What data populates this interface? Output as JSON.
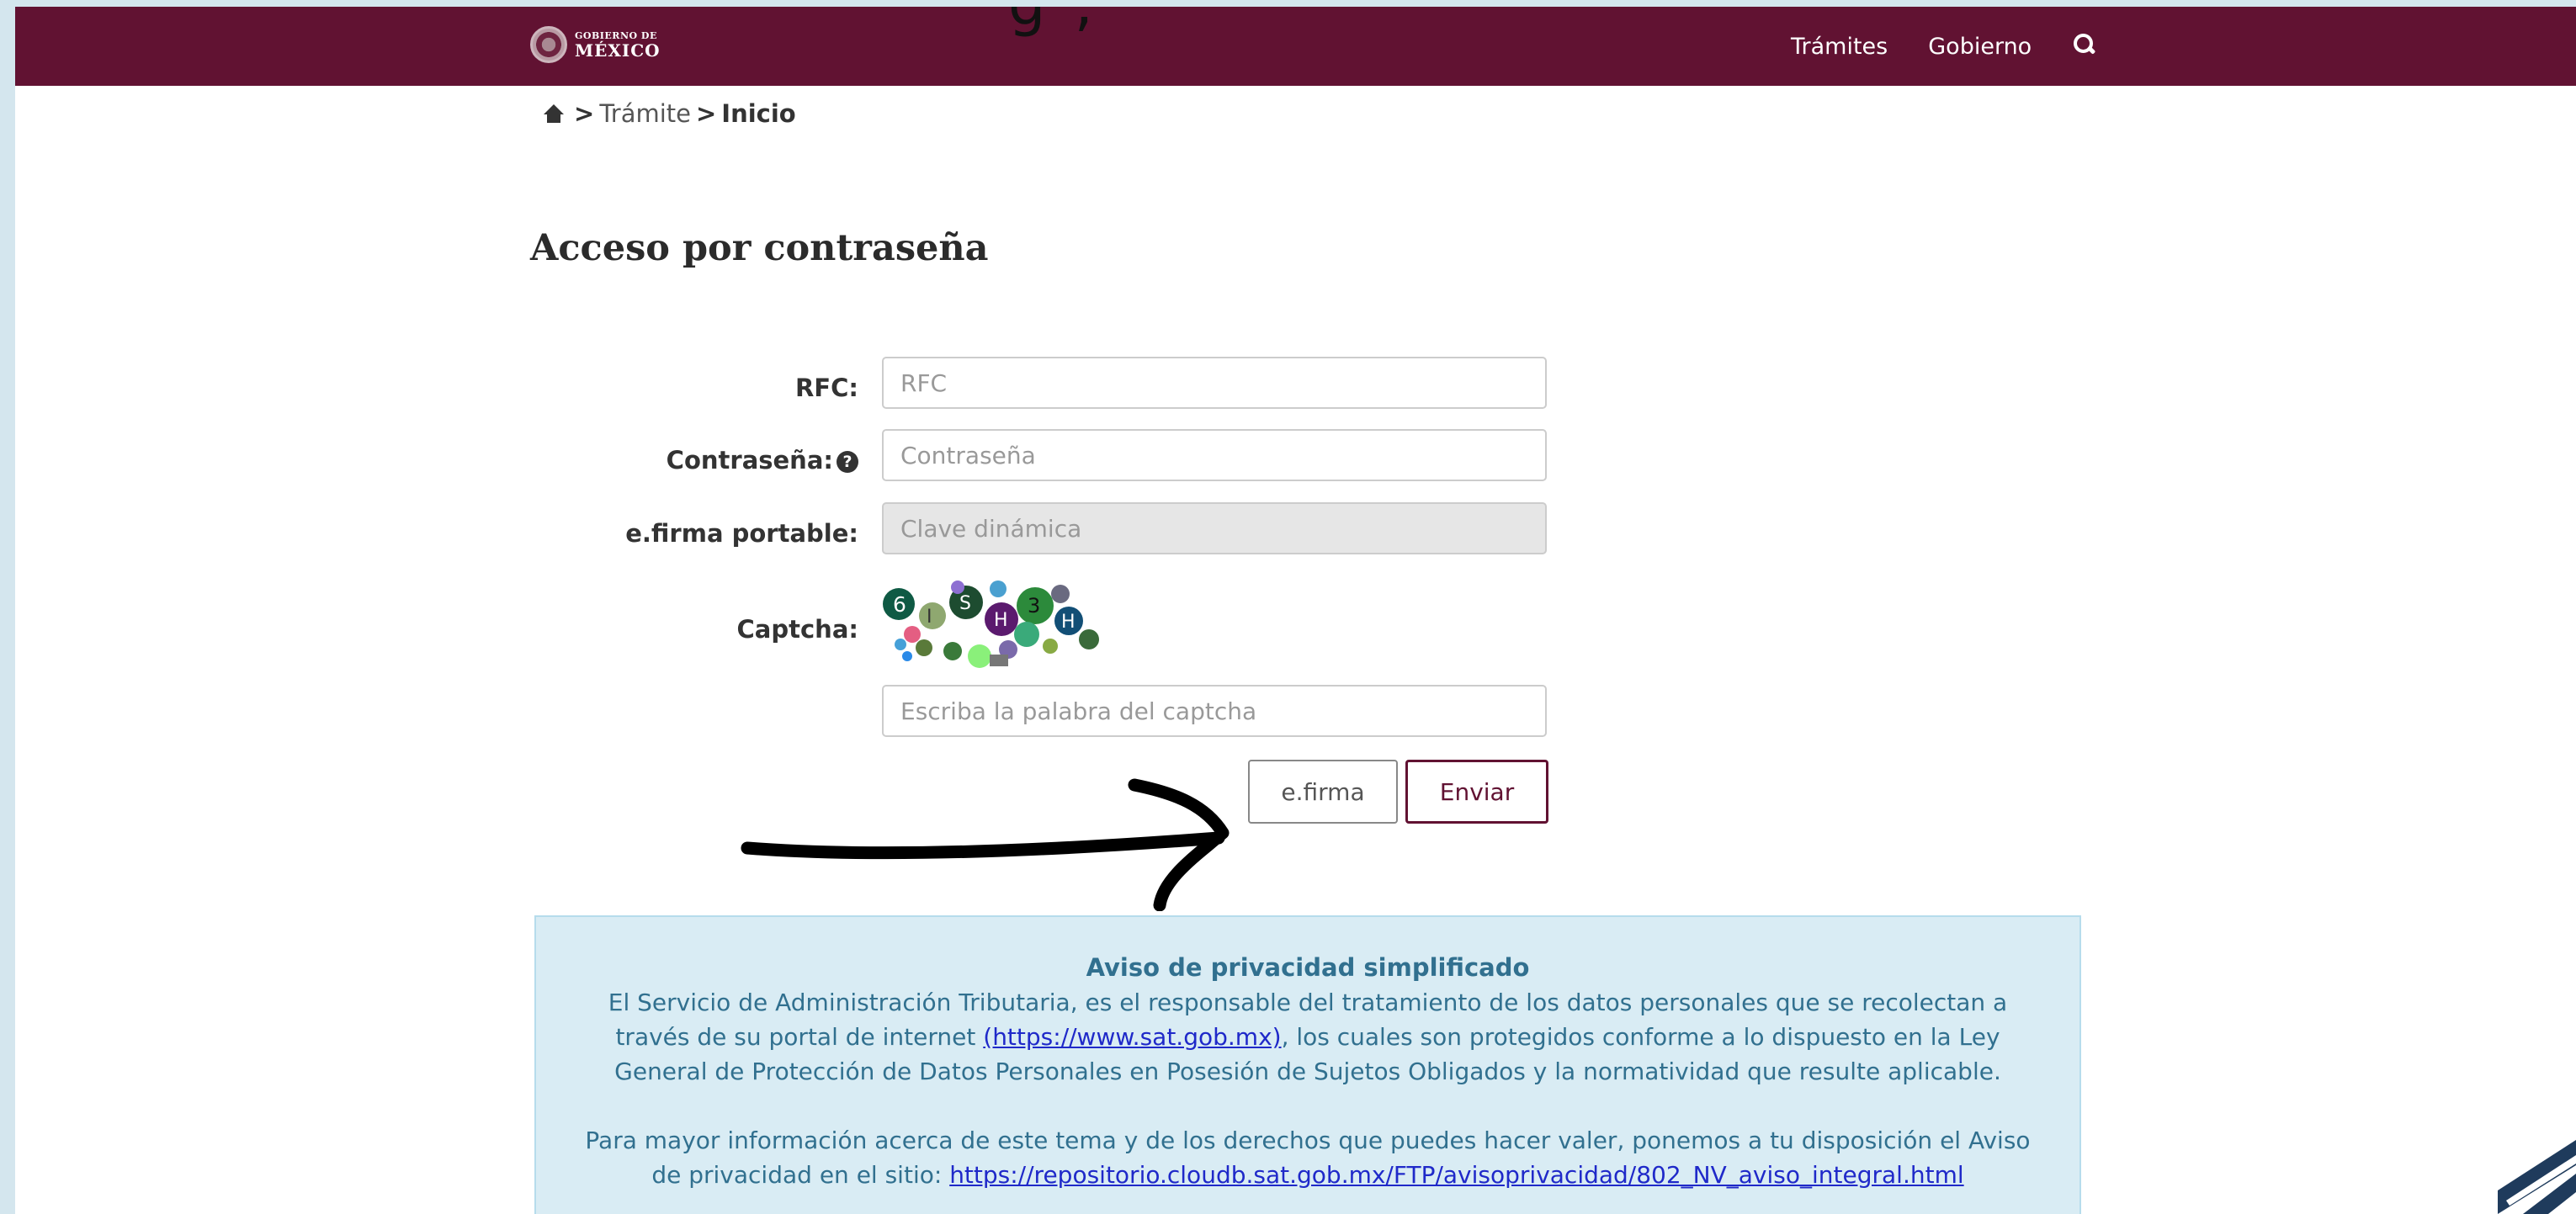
{
  "navbar": {
    "logo_small": "GOBIERNO DE",
    "logo_big": "MÉXICO",
    "links": [
      "Trámites",
      "Gobierno"
    ],
    "search_icon": "search-icon",
    "bg_color": "#611232"
  },
  "breadcrumb": {
    "home_icon": "home-icon",
    "separator": ">",
    "items": [
      "Trámite",
      "Inicio"
    ]
  },
  "page": {
    "title": "Acceso por contraseña"
  },
  "form": {
    "rfc_label": "RFC:",
    "rfc_placeholder": "RFC",
    "password_label": "Contraseña:",
    "password_placeholder": "Contraseña",
    "help_icon": "question-circle-icon",
    "efirma_label": "e.firma portable:",
    "efirma_placeholder": "Clave dinámica",
    "captcha_label": "Captcha:",
    "captcha_placeholder": "Escriba la palabra del captcha",
    "btn_efirma": "e.firma",
    "btn_enviar": "Enviar"
  },
  "privacy": {
    "title": "Aviso de privacidad simplificado",
    "p1_a": "El Servicio de Administración Tributaria, es el responsable del tratamiento de los datos personales que se recolectan a través de su portal de internet ",
    "p1_link": "(https://www.sat.gob.mx)",
    "p1_b": ", los cuales son protegidos conforme a lo dispuesto en la Ley General de Protección de Datos Personales en Posesión de Sujetos Obligados y la normatividad que resulte aplicable.",
    "p2_a": "Para mayor información acerca de este tema y de los derechos que puedes hacer valer, ponemos a tu disposición el Aviso de privacidad en el sitio: ",
    "p2_link": "https://repositorio.cloudb.sat.gob.mx/FTP/avisoprivacidad/802_NV_aviso_integral.html"
  },
  "overlay": {
    "top_cut_text": "g     ,",
    "arrow_icon": "hand-drawn-arrow-icon",
    "corner_icon": "corner-logo-icon"
  }
}
